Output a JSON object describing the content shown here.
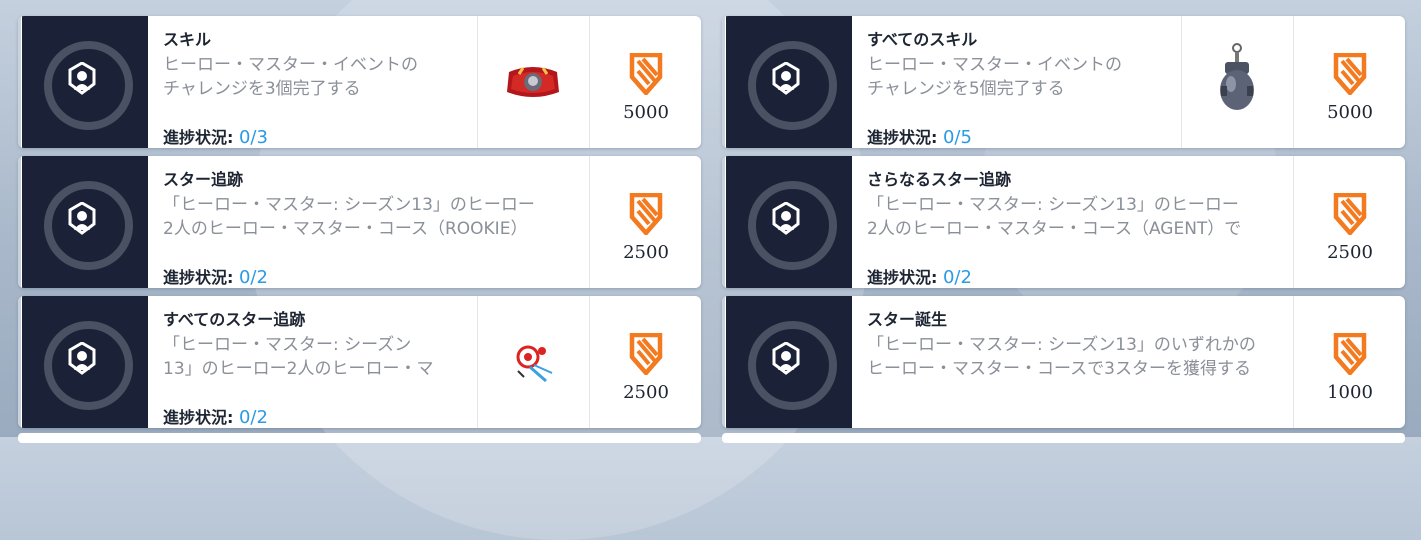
{
  "progress_label": "進捗状況:",
  "challenges": [
    {
      "title": "スキル",
      "desc_line1": "ヒーロー・マスター・イベントの",
      "desc_line2": "チャレンジを3個完了する",
      "progress": "0/3",
      "points": "5000",
      "reward_item": "spray-reward-icon"
    },
    {
      "title": "すべてのスキル",
      "desc_line1": "ヒーロー・マスター・イベントの",
      "desc_line2": "チャレンジを5個完了する",
      "progress": "0/5",
      "points": "5000",
      "reward_item": "weapon-charm-reward-icon"
    },
    {
      "title": "スター追跡",
      "desc_line1": "「ヒーロー・マスター: シーズン13」のヒーロー",
      "desc_line2": "2人のヒーロー・マスター・コース（ROOKIE）",
      "progress": "0/2",
      "points": "2500"
    },
    {
      "title": "さらなるスター追跡",
      "desc_line1": "「ヒーロー・マスター: シーズン13」のヒーロー",
      "desc_line2": "2人のヒーロー・マスター・コース（AGENT）で",
      "progress": "0/2",
      "points": "2500"
    },
    {
      "title": "すべてのスター追跡",
      "desc_line1": "「ヒーロー・マスター: シーズン",
      "desc_line2": "13」のヒーロー2人のヒーロー・マ",
      "progress": "0/2",
      "points": "2500",
      "reward_item": "player-icon-reward"
    },
    {
      "title": "スター誕生",
      "desc_line1": "「ヒーロー・マスター: シーズン13」のいずれかの",
      "desc_line2": "ヒーロー・マスター・コースで3スターを獲得する",
      "points": "1000"
    }
  ],
  "colors": {
    "accent_orange": "#f47a20",
    "progress_blue": "#2b9be3",
    "icon_panel": "#1b2238"
  }
}
